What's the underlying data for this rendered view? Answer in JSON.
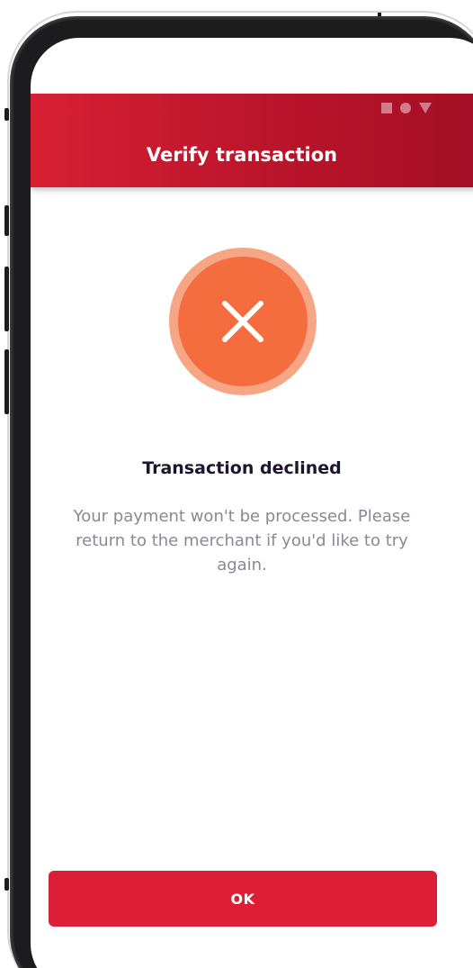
{
  "header": {
    "title": "Verify transaction",
    "status_icons": [
      "square-icon",
      "circle-icon",
      "triangle-icon"
    ]
  },
  "result": {
    "icon": "close-x-icon",
    "title": "Transaction declined",
    "message": "Your payment won't be processed. Please return to the merchant if you'd like to try again."
  },
  "actions": {
    "ok_label": "OK"
  },
  "colors": {
    "brand_red": "#dc1f36",
    "header_dark": "#a30e24",
    "error_orange": "#f56c3f",
    "error_ring": "#f6a685",
    "title_text": "#1f1430",
    "body_text": "#8a8894"
  }
}
